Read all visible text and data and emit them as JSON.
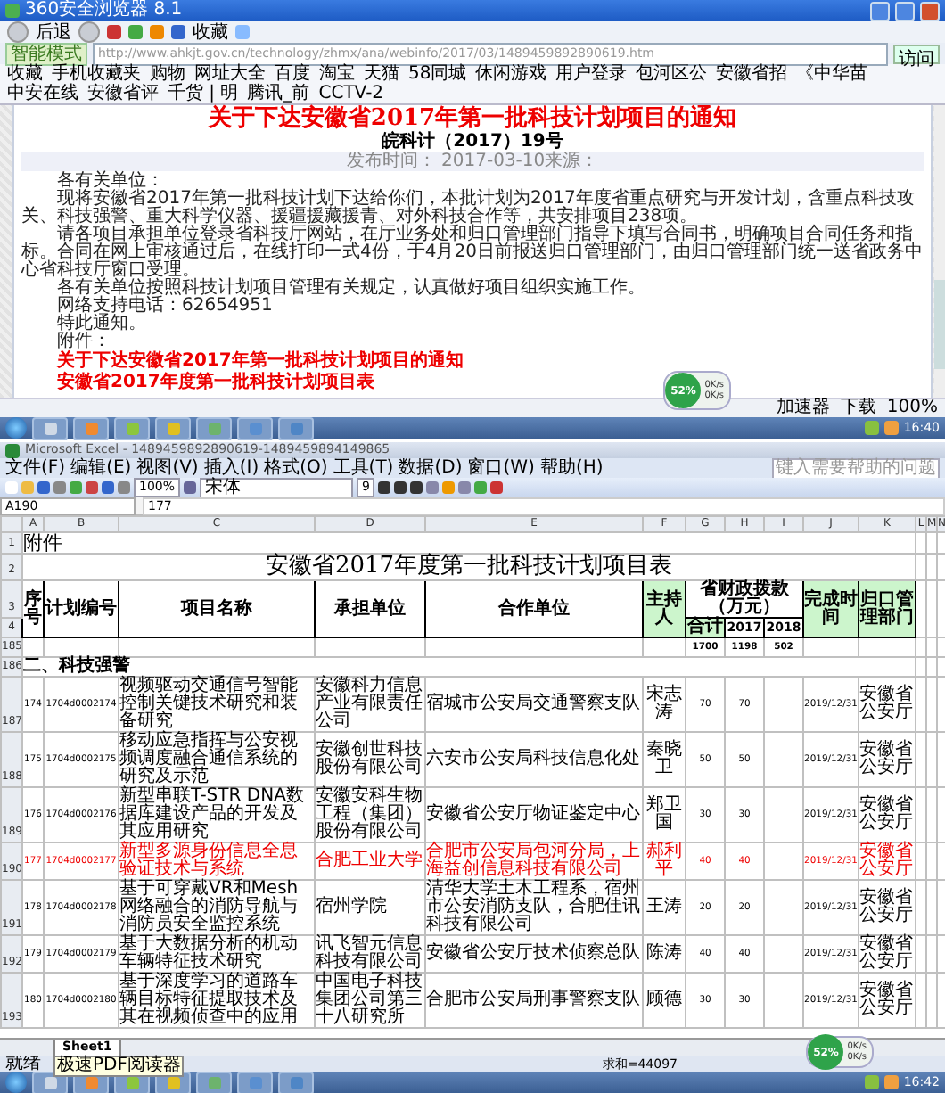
{
  "browser": {
    "title": "360安全浏览器 8.1",
    "toolbar": {
      "back": "后退",
      "favorites": "收藏"
    },
    "address_bar": {
      "mode": "智能模式",
      "url": "http://www.ahkjt.gov.cn/technology/zhmx/ana/webinfo/2017/03/1489459892890619.htm",
      "go": "访问"
    },
    "bookmarks": [
      "收藏",
      "手机收藏夹",
      "购物",
      "网址大全",
      "百度",
      "淘宝",
      "天猫",
      "58同城",
      "休闲游戏",
      "用户登录",
      "包河区公",
      "安徽省招",
      "《中华苗",
      "中安在线",
      "安徽省评",
      "千货 | 明",
      "腾讯_前",
      "CCTV-2"
    ],
    "document": {
      "title": "关于下达安徽省2017年第一批科技计划项目的通知",
      "number": "皖科计（2017）19号",
      "meta": "发布时间：  2017-03-10来源：",
      "paragraphs": [
        "各有关单位：",
        "现将安徽省2017年第一批科技计划下达给你们，本批计划为2017年度省重点研究与开发计划，含重点科技攻关、科技强警、重大科学仪器、援疆援藏援青、对外科技合作等，共安排项目238项。",
        "请各项目承担单位登录省科技厅网站，在厅业务处和归口管理部门指导下填写合同书，明确项目合同任务和指标。合同在网上审核通过后，在线打印一式4份，于4月20日前报送归口管理部门，由归口管理部门统一送省政务中心省科技厅窗口受理。",
        "各有关单位按照科技计划项目管理有关规定，认真做好项目组织实施工作。",
        "网络支持电话：62654951",
        "特此通知。",
        "附件："
      ],
      "attachments": [
        "关于下达安徽省2017年第一批科技计划项目的通知",
        "安徽省2017年度第一批科技计划项目表"
      ]
    },
    "status_bar": [
      "加速器",
      "下载",
      "100%"
    ],
    "speed_widget": {
      "percent": "52%",
      "rates": [
        "0K/s",
        "0K/s"
      ]
    },
    "taskbar": {
      "time": "16:40"
    }
  },
  "excel": {
    "title": "Microsoft Excel - 1489459892890619-1489459894149865",
    "menu": [
      "文件(F)",
      "编辑(E)",
      "视图(V)",
      "插入(I)",
      "格式(O)",
      "工具(T)",
      "数据(D)",
      "窗口(W)",
      "帮助(H)"
    ],
    "help_placeholder": "键入需要帮助的问题",
    "zoom": "100%",
    "font": "宋体",
    "font_size": "9",
    "name_box": "A190",
    "formula": "177",
    "columns": [
      "A",
      "B",
      "C",
      "D",
      "E",
      "F",
      "G",
      "H",
      "I",
      "J",
      "K",
      "L",
      "M",
      "N"
    ],
    "rows": [
      {
        "kind": "note",
        "number": "1",
        "text": "附件"
      },
      {
        "kind": "title",
        "number": "2",
        "title": "安徽省2017年度第一批科技计划项目表"
      },
      {
        "kind": "header",
        "numbers": [
          "3",
          "4"
        ],
        "cells": [
          "序号",
          "计划编号",
          "项目名称",
          "承担单位",
          "合作单位",
          "主持人"
        ],
        "funding": "省财政拨款（万元）",
        "funding_columns": [
          "合计",
          "2017",
          "2018"
        ],
        "tail": [
          "完成时间",
          "归口管理部门"
        ]
      },
      {
        "kind": "totals",
        "number": "185",
        "values": [
          "1700",
          "1198",
          "502"
        ]
      },
      {
        "kind": "section",
        "number": "186",
        "text": "二、科技强警"
      },
      {
        "kind": "item",
        "number": "187",
        "highlighted": false,
        "seq": "174",
        "code": "1704d0002174",
        "name": "视频驱动交通信号智能控制关键技术研究和装备研究",
        "unit": "安徽科力信息产业有限责任公司",
        "partner": "宿城市公安局交通警察支队",
        "leader": "宋志涛",
        "total": "70",
        "y2017": "70",
        "finish": "2019/12/31",
        "dept": "安徽省公安厅"
      },
      {
        "kind": "item",
        "number": "188",
        "highlighted": false,
        "seq": "175",
        "code": "1704d0002175",
        "name": "移动应急指挥与公安视频调度融合通信系统的研究及示范",
        "unit": "安徽创世科技股份有限公司",
        "partner": "六安市公安局科技信息化处",
        "leader": "秦晓卫",
        "total": "50",
        "y2017": "50",
        "finish": "2019/12/31",
        "dept": "安徽省公安厅"
      },
      {
        "kind": "item",
        "number": "189",
        "highlighted": false,
        "seq": "176",
        "code": "1704d0002176",
        "name": "新型串联T-STR DNA数据库建设产品的开发及其应用研究",
        "unit": "安徽安科生物工程（集团）股份有限公司",
        "partner": "安徽省公安厅物证鉴定中心",
        "leader": "郑卫国",
        "total": "30",
        "y2017": "30",
        "finish": "2019/12/31",
        "dept": "安徽省公安厅"
      },
      {
        "kind": "item",
        "number": "190",
        "highlighted": true,
        "seq": "177",
        "code": "1704d0002177",
        "name": "新型多源身份信息全息验证技术与系统",
        "unit": "合肥工业大学",
        "partner": "合肥市公安局包河分局，上海益创信息科技有限公司",
        "leader": "郝利平",
        "total": "40",
        "y2017": "40",
        "finish": "2019/12/31",
        "dept": "安徽省公安厅"
      },
      {
        "kind": "item",
        "number": "191",
        "highlighted": false,
        "seq": "178",
        "code": "1704d0002178",
        "name": "基于可穿戴VR和Mesh网络融合的消防导航与消防员安全监控系统",
        "unit": "宿州学院",
        "partner": "清华大学土木工程系，宿州市公安消防支队，合肥佳讯科技有限公司",
        "leader": "王涛",
        "total": "20",
        "y2017": "20",
        "finish": "2019/12/31",
        "dept": "安徽省公安厅"
      },
      {
        "kind": "item",
        "number": "192",
        "highlighted": false,
        "seq": "179",
        "code": "1704d0002179",
        "name": "基于大数据分析的机动车辆特征技术研究",
        "unit": "讯飞智元信息科技有限公司",
        "partner": "安徽省公安厅技术侦察总队",
        "leader": "陈涛",
        "total": "40",
        "y2017": "40",
        "finish": "2019/12/31",
        "dept": "安徽省公安厅"
      },
      {
        "kind": "item",
        "number": "193",
        "highlighted": false,
        "seq": "180",
        "code": "1704d0002180",
        "name": "基于深度学习的道路车辆目标特征提取技术及其在视频侦查中的应用",
        "unit": "中国电子科技集团公司第三十八研究所",
        "partner": "合肥市公安局刑事警察支队",
        "leader": "顾德",
        "total": "30",
        "y2017": "30",
        "finish": "2019/12/31",
        "dept": "安徽省公安厅"
      }
    ],
    "sheet_tabs": [
      {
        "label": "Sheet1",
        "selected": true
      }
    ],
    "tooltip": "极速PDF阅读器",
    "status": "就绪",
    "sum": "求和=44097",
    "speed_widget": {
      "percent": "52%",
      "rates": [
        "0K/s",
        "0K/s"
      ]
    },
    "taskbar": {
      "time": "16:42"
    }
  }
}
